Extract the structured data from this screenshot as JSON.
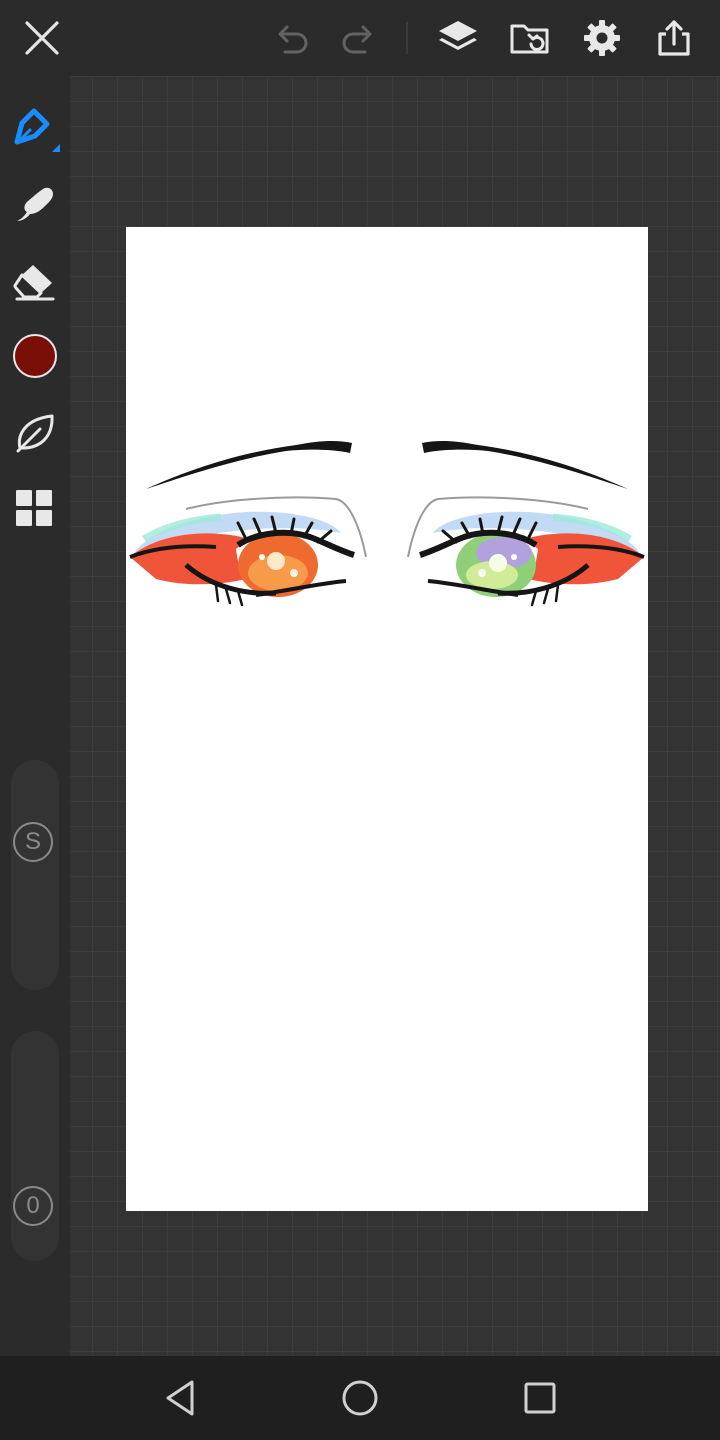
{
  "app": {
    "toolbar": {
      "close": "close-icon",
      "undo": "undo-icon",
      "redo": "redo-icon",
      "layers": "layers-icon",
      "gallery": "gallery-icon",
      "settings": "gear-icon",
      "export": "share-icon"
    },
    "tools": [
      {
        "name": "pen",
        "icon": "pen-icon",
        "active": true
      },
      {
        "name": "smudge",
        "icon": "smudge-icon",
        "active": false
      },
      {
        "name": "eraser",
        "icon": "eraser-icon",
        "active": false
      },
      {
        "name": "color",
        "icon": "color-swatch-icon",
        "active": false
      },
      {
        "name": "stabilizer",
        "icon": "leaf-icon",
        "active": false
      },
      {
        "name": "more",
        "icon": "grid-icon",
        "active": false
      }
    ],
    "size_slider": {
      "label": "S"
    },
    "opacity_slider": {
      "label": "0"
    },
    "colors": {
      "accent": "#1a8cff",
      "current_color": "#7a0f08",
      "background": "#2b2b2b",
      "workspace": "#333333",
      "canvas": "#ffffff"
    },
    "navigation": {
      "back": "back-icon",
      "home": "home-icon",
      "recents": "recents-icon"
    }
  }
}
